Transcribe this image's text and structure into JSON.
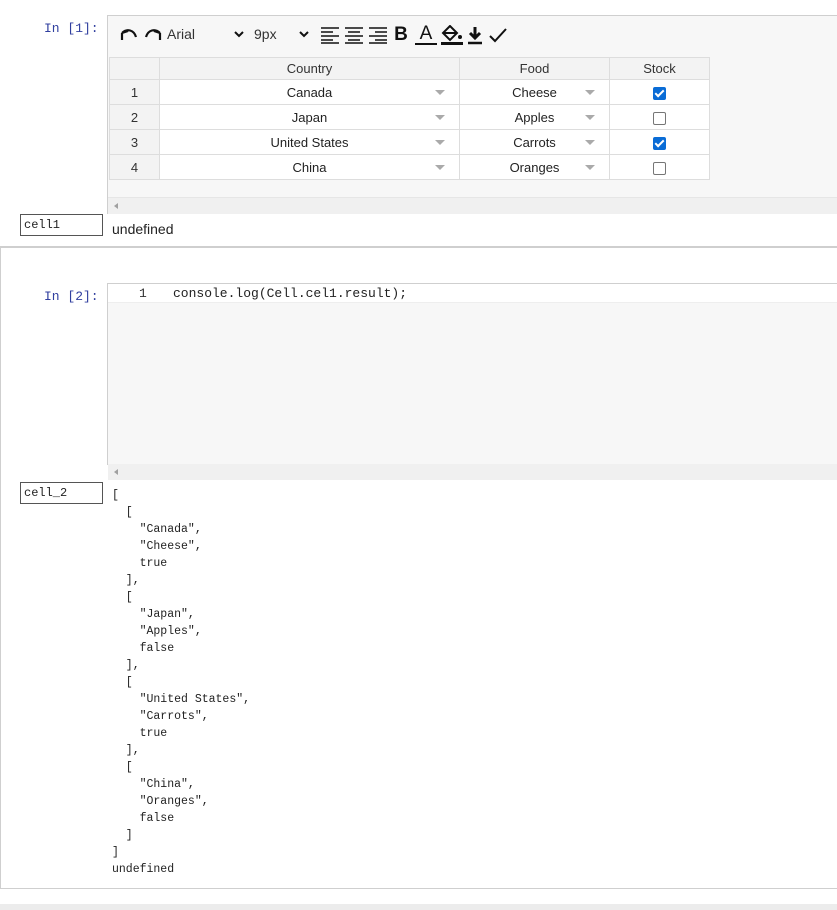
{
  "cell1": {
    "prompt": "In [1]:",
    "toolbar": {
      "font": "Arial",
      "size": "9px",
      "bold": "B",
      "text_color": "A"
    },
    "table": {
      "headers": [
        "Country",
        "Food",
        "Stock"
      ],
      "rows": [
        {
          "num": "1",
          "country": "Canada",
          "food": "Cheese",
          "stock": true
        },
        {
          "num": "2",
          "country": "Japan",
          "food": "Apples",
          "stock": false
        },
        {
          "num": "3",
          "country": "United States",
          "food": "Carrots",
          "stock": true
        },
        {
          "num": "4",
          "country": "China",
          "food": "Oranges",
          "stock": false
        }
      ]
    },
    "name": "cell1",
    "output": "undefined"
  },
  "cell2": {
    "prompt": "In [2]:",
    "line_number": "1",
    "code": "console.log(Cell.cel1.result);",
    "name": "cell_2",
    "output": "[\n  [\n    \"Canada\",\n    \"Cheese\",\n    true\n  ],\n  [\n    \"Japan\",\n    \"Apples\",\n    false\n  ],\n  [\n    \"United States\",\n    \"Carrots\",\n    true\n  ],\n  [\n    \"China\",\n    \"Oranges\",\n    false\n  ]\n]\nundefined"
  },
  "colors": {
    "prompt": "#303f9f",
    "checkbox_checked": "#0a6cd6"
  }
}
